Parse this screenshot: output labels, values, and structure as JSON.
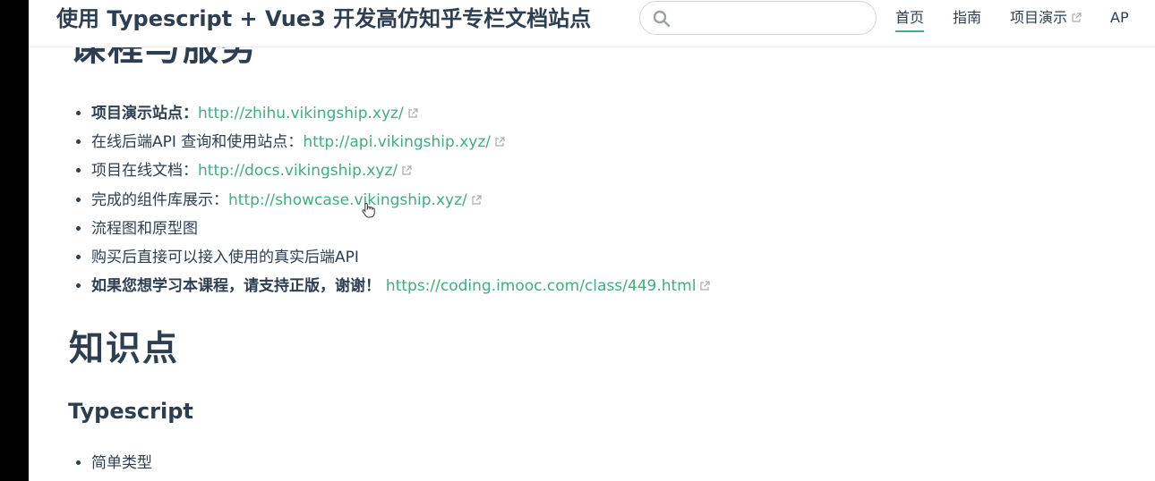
{
  "site": {
    "title": "使用 Typescript + Vue3 开发高仿知乎专栏文档站点"
  },
  "search": {
    "value": "",
    "placeholder": ""
  },
  "nav": {
    "items": [
      {
        "label": "首页",
        "active": true,
        "external": false
      },
      {
        "label": "指南",
        "active": false,
        "external": false
      },
      {
        "label": "项目演示",
        "active": false,
        "external": true
      },
      {
        "label": "AP",
        "active": false,
        "external": false
      }
    ]
  },
  "content": {
    "partial_heading": "课程与服务",
    "links": [
      {
        "prefix": "项目演示站点：",
        "prefix_bold": true,
        "url": "http://zhihu.vikingship.xyz/"
      },
      {
        "prefix": "在线后端API 查询和使用站点：",
        "prefix_bold": false,
        "url": "http://api.vikingship.xyz/"
      },
      {
        "prefix": "项目在线文档：",
        "prefix_bold": false,
        "url": "http://docs.vikingship.xyz/"
      },
      {
        "prefix": "完成的组件库展示：",
        "prefix_bold": false,
        "url": "http://showcase.vikingship.xyz/"
      },
      {
        "prefix": "流程图和原型图",
        "prefix_bold": false,
        "url": ""
      },
      {
        "prefix": "购买后直接可以接入使用的真实后端API",
        "prefix_bold": false,
        "url": ""
      },
      {
        "prefix": "如果您想学习本课程，请支持正版，谢谢！ ",
        "prefix_bold": true,
        "url": "https://coding.imooc.com/class/449.html"
      }
    ],
    "heading1": "知识点",
    "heading2": "Typescript",
    "sub_items": [
      "简单类型"
    ]
  },
  "colors": {
    "accent": "#3eaf7c",
    "text": "#2c3e50",
    "border": "#eaecef"
  }
}
